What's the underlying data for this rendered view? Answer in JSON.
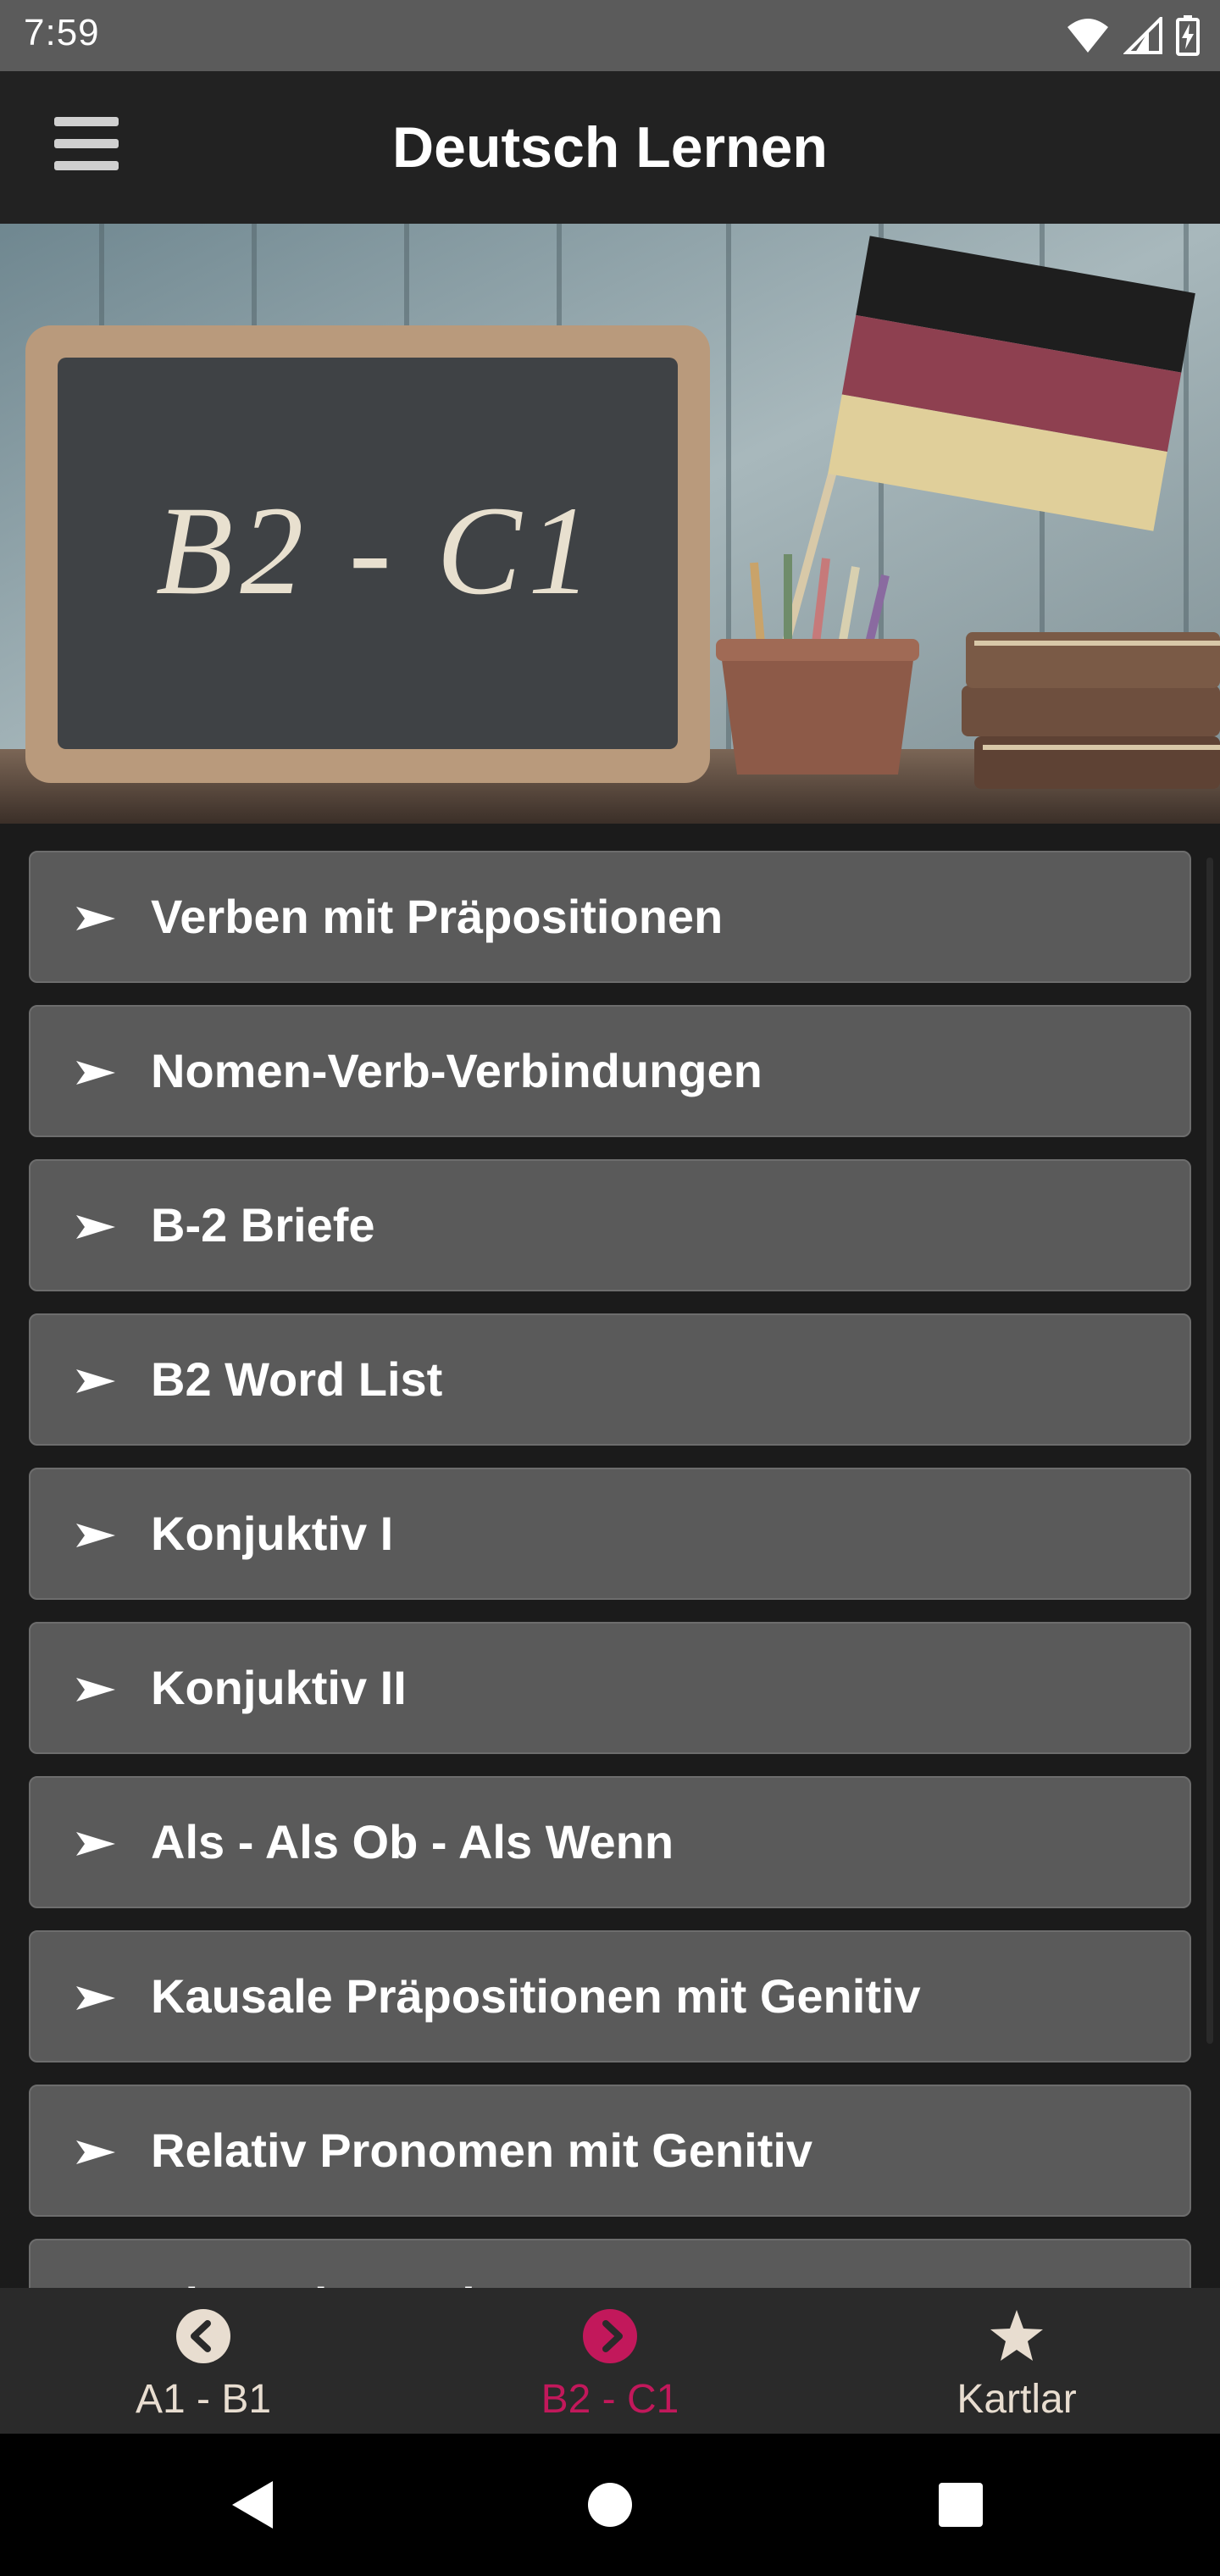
{
  "status_bar": {
    "time": "7:59",
    "icons": [
      "wifi-icon",
      "signal-icon",
      "battery-charging-icon"
    ]
  },
  "app_bar": {
    "title": "Deutsch Lernen",
    "menu_icon": "hamburger-menu-icon"
  },
  "hero": {
    "chalkboard_text": "B2 - C1"
  },
  "list": {
    "items": [
      {
        "label": "Verben mit Präpositionen"
      },
      {
        "label": "Nomen-Verb-Verbindungen"
      },
      {
        "label": "B-2 Briefe"
      },
      {
        "label": "B2 Word List"
      },
      {
        "label": "Konjuktiv I"
      },
      {
        "label": "Konjuktiv II"
      },
      {
        "label": "Als - Als Ob - Als Wenn"
      },
      {
        "label": "Kausale Präpositionen mit Genitiv"
      },
      {
        "label": "Relativ Pronomen mit Genitiv"
      },
      {
        "label": "Die Redewendungen"
      }
    ]
  },
  "bottom_nav": {
    "items": [
      {
        "label": "A1 - B1",
        "icon": "chevron-left-circle-icon",
        "active": false
      },
      {
        "label": "B2 - C1",
        "icon": "chevron-right-circle-icon",
        "active": true
      },
      {
        "label": "Kartlar",
        "icon": "star-icon",
        "active": false
      }
    ]
  },
  "colors": {
    "status_bar": "#5b5b5b",
    "app_bar": "#222222",
    "list_item": "#5a5a5a",
    "nav_active": "#c2185b",
    "nav_inactive": "#e8ddd0"
  }
}
